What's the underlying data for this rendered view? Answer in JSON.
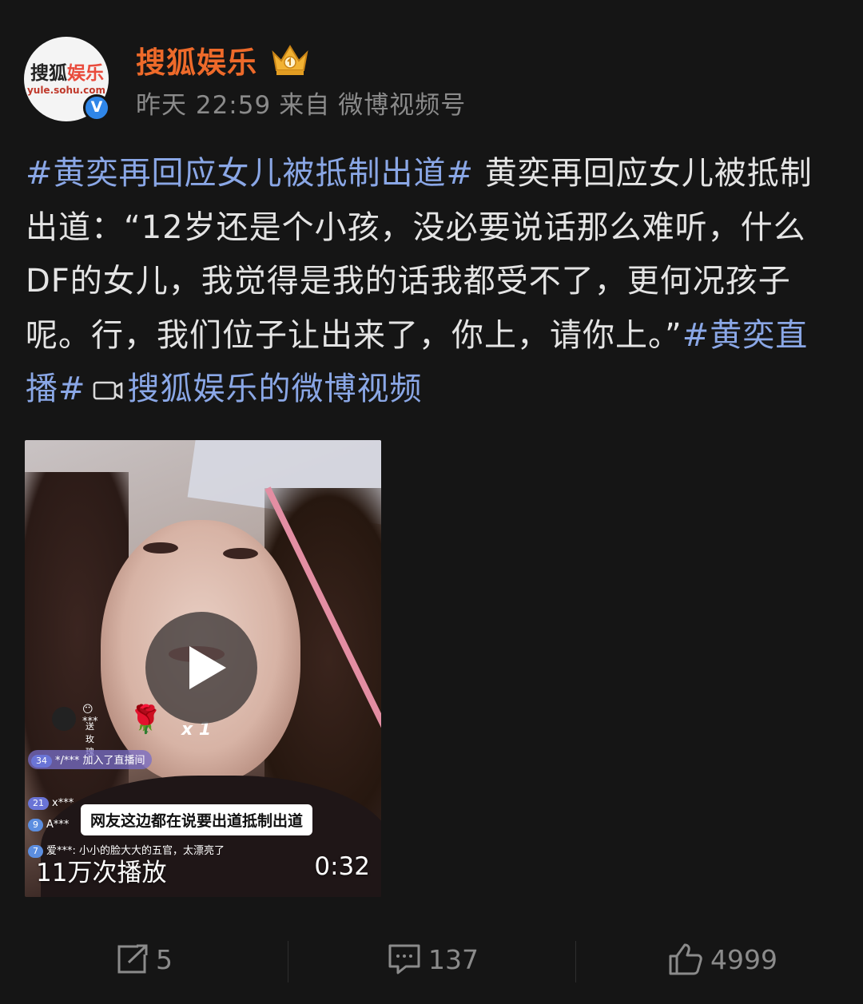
{
  "account": {
    "avatar_logo_main": "搜狐",
    "avatar_logo_accent": "娱乐",
    "avatar_url_text": "yule.sohu.com",
    "name": "搜狐娱乐",
    "verified_mark": "V",
    "badge_icon": "crown-icon"
  },
  "post_meta": {
    "time": "昨天 22:59",
    "source_prefix": "来自",
    "source": "微博视频号"
  },
  "post": {
    "hashtag1": "#黄奕再回应女儿被抵制出道#",
    "body": " 黄奕再回应女儿被抵制出道：“12岁还是个小孩，没必要说话那么难听，什么DF的女儿，我觉得是我的话我都受不了，更何况孩子呢。行，我们位子让出来了，你上，请你上。”",
    "hashtag2": "#黄奕直播#",
    "video_link_icon": "video-camera-icon",
    "video_link": "搜狐娱乐的微博视频"
  },
  "video": {
    "play_count": "11万次播放",
    "duration": "0:32",
    "overlay": {
      "top_user": "***",
      "top_user_sub": "送玫瑰",
      "rose_multiplier": "x 1",
      "join_level": "34",
      "join_user": "*/***",
      "join_text": "加入了直播间",
      "row2_level": "21",
      "row2_user": "x***",
      "row3_level": "9",
      "row3_user": "A***",
      "caption": "网友这边都在说要出道抵制出道",
      "row4_level": "7",
      "row4_user": "爱***:",
      "row4_text": "小小的脸大大的五官，太漂亮了"
    }
  },
  "actions": {
    "repost_count": "5",
    "comment_count": "137",
    "like_count": "4999"
  },
  "colors": {
    "background": "#151515",
    "hashtag": "#8aa7e6",
    "account_name": "#ee6a2a",
    "meta": "#8a8a8a",
    "verified": "#2f86e8"
  }
}
